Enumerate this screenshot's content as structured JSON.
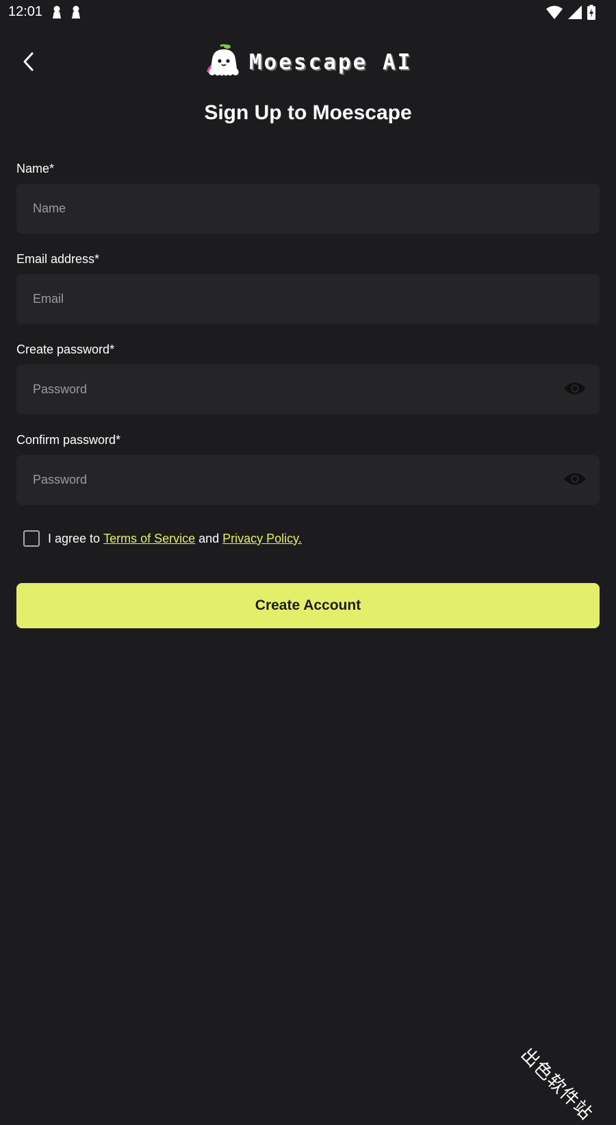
{
  "status_bar": {
    "time": "12:01",
    "icons": [
      "notification-icon",
      "notification-icon",
      "wifi-icon",
      "signal-icon",
      "battery-charging-icon"
    ]
  },
  "header": {
    "back_icon": "chevron-left-icon",
    "logo_text": "Moescape AI",
    "logo_icon": "ghost-mascot-icon"
  },
  "title": "Sign Up to Moescape",
  "form": {
    "name": {
      "label": "Name*",
      "placeholder": "Name",
      "value": ""
    },
    "email": {
      "label": "Email address*",
      "placeholder": "Email",
      "value": ""
    },
    "password": {
      "label": "Create password*",
      "placeholder": "Password",
      "value": "",
      "toggle_icon": "eye-icon"
    },
    "confirm_password": {
      "label": "Confirm password*",
      "placeholder": "Password",
      "value": "",
      "toggle_icon": "eye-icon"
    }
  },
  "agreement": {
    "checked": false,
    "prefix": "I agree to ",
    "terms_link": "Terms of Service",
    "middle": " and ",
    "privacy_link": "Privacy Policy."
  },
  "submit_label": "Create Account",
  "watermark": "出色软件站",
  "colors": {
    "background": "#1c1c1e",
    "field_background": "#252528",
    "accent": "#e3ef6a",
    "placeholder": "#9b9b9f"
  }
}
